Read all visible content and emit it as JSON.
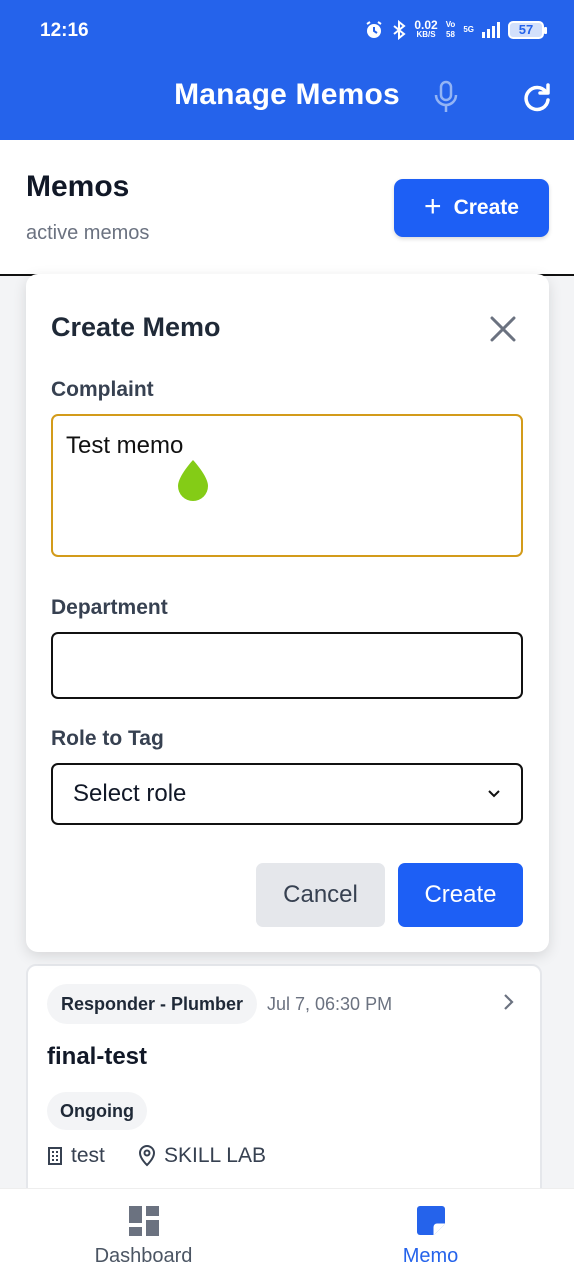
{
  "status_bar": {
    "time": "12:16",
    "net_speed": "0.02",
    "net_unit": "KB/S",
    "vo": "Vo",
    "vo_sub": "58",
    "network_type": "5G",
    "battery": "57"
  },
  "app_bar": {
    "title": "Manage Memos",
    "mic_icon": "mic-icon",
    "refresh_icon": "refresh-icon",
    "bg_color": "#2563eb"
  },
  "page": {
    "title": "Memos",
    "subtitle": "active memos",
    "create_button": {
      "icon": "+",
      "label": "Create"
    }
  },
  "modal": {
    "title": "Create Memo",
    "fields": {
      "complaint": {
        "label": "Complaint",
        "value": "Test memo"
      },
      "department": {
        "label": "Department",
        "value": ""
      },
      "role": {
        "label": "Role to Tag",
        "selected": "Select role"
      }
    },
    "cancel_label": "Cancel",
    "create_label": "Create"
  },
  "memos": [
    {
      "role": "Responder - Plumber",
      "date": "Jul 7, 06:30 PM",
      "title": "final-test",
      "status": "Ongoing",
      "building": "test",
      "location": "SKILL LAB"
    }
  ],
  "bottom_nav": {
    "items": [
      {
        "label": "Dashboard",
        "icon": "dashboard-icon",
        "active": false
      },
      {
        "label": "Memo",
        "icon": "memo-icon",
        "active": true
      }
    ],
    "active_color": "#2563eb"
  }
}
